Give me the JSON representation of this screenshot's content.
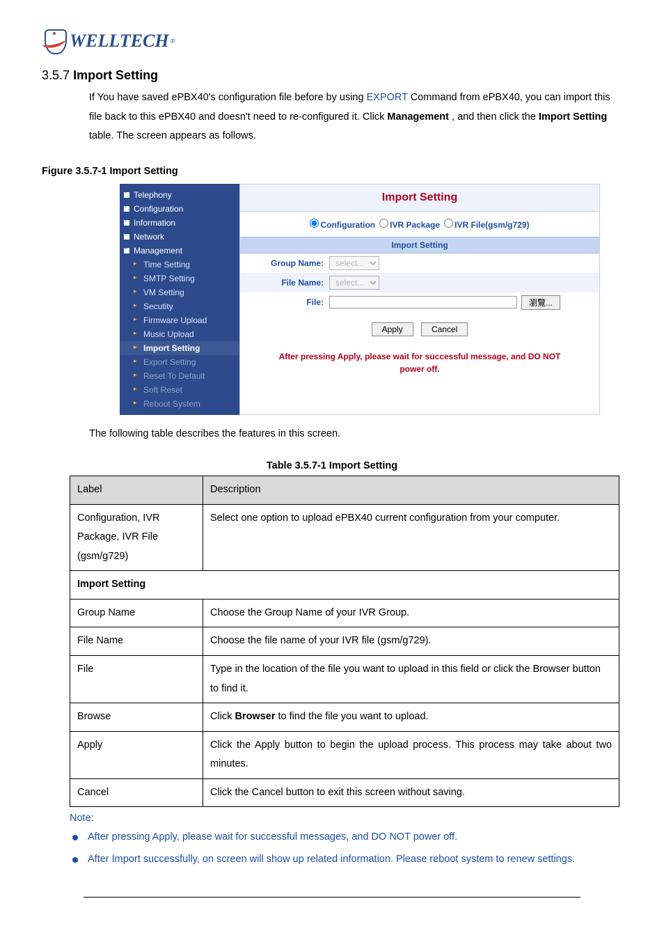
{
  "logo": {
    "text": "WELLTECH",
    "reg": "®"
  },
  "section": {
    "number": "3.5.7",
    "title": "Import Setting",
    "intro": "If You have saved ePBX40's configuration file before by using ",
    "intro_link": "EXPORT",
    "intro2": " Command from ePBX40, you can import this file back to this ePBX40 and doesn't need to re-configured it. Click ",
    "intro_bold1": "Management",
    "intro3": ", and then click the ",
    "intro_bold2": "Import Setting",
    "intro4": " table. The screen appears as follows."
  },
  "figure_caption": "Figure   3.5.7-1 Import Setting",
  "app": {
    "sidebar": {
      "top": [
        "Telephony",
        "Configuration",
        "Information",
        "Network",
        "Management"
      ],
      "subs": [
        "Time Setting",
        "SMTP Setting",
        "VM Setting",
        "Secutity",
        "Firmware Upload",
        "Music Upload",
        "Import Setting",
        "Export Setting",
        "Reset To Default",
        "Soft Reset",
        "Reboot System"
      ]
    },
    "panel": {
      "title": "Import Setting",
      "radios": {
        "r1": "Configuration",
        "r2": "IVR Package",
        "r3": "IVR File(gsm/g729)"
      },
      "import_header": "Import Setting",
      "group_name_label": "Group Name:",
      "group_name_value": "select...",
      "file_name_label": "File Name:",
      "file_name_value": "select...",
      "file_label": "File:",
      "browse_label": "瀏覽...",
      "apply": "Apply",
      "cancel": "Cancel",
      "warn1": "After pressing Apply, please wait for successful message, and DO NOT",
      "warn2": "power off."
    }
  },
  "post_text": "The following table describes the features in this screen.",
  "table_caption": "Table 3.5.7-1 Import Setting",
  "table": {
    "h1": "Label",
    "h2": "Description",
    "rows": [
      {
        "label": "Configuration, IVR Package, IVR File (gsm/g729)",
        "desc": "Select one option to upload ePBX40 current configuration from your computer."
      },
      {
        "span": "Import Setting"
      },
      {
        "label": "Group Name",
        "desc": "Choose the Group Name of your IVR Group."
      },
      {
        "label": "File Name",
        "desc": "Choose the file name of your IVR file (gsm/g729)."
      },
      {
        "label": "File",
        "desc": "Type in the location of the file you want to upload in this field or click the Browser button to find it."
      },
      {
        "label": "Browse",
        "desc_pre": "Click ",
        "desc_bold": "Browser",
        "desc_post": " to find the file you want to upload."
      },
      {
        "label": "Apply",
        "desc": "Click the Apply button to begin the upload process. This process may take about two minutes."
      },
      {
        "label": "Cancel",
        "desc": "Click the Cancel button to exit this screen without saving."
      }
    ]
  },
  "note_label": "Note:",
  "bullets": [
    "After pressing Apply, please wait for successful messages, and DO NOT power off.",
    "After Import successfully, on screen will show up related information. Please reboot system to renew settings."
  ]
}
